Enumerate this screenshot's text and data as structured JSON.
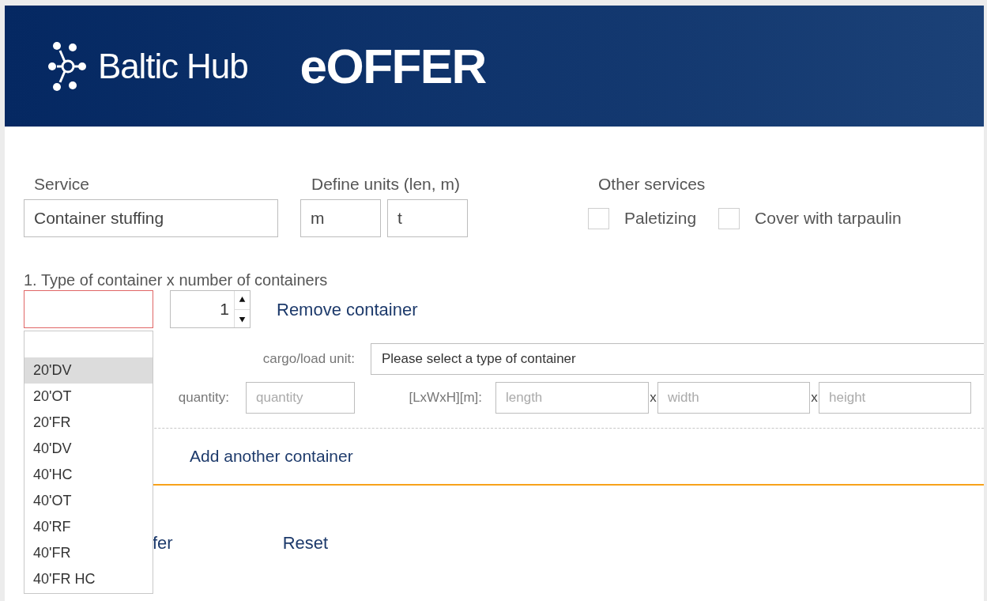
{
  "header": {
    "logo_text": "Baltic Hub",
    "app_title": "eOFFER"
  },
  "service": {
    "label": "Service",
    "value": "Container stuffing"
  },
  "units": {
    "label": "Define units (len, m)",
    "length": "m",
    "weight": "t"
  },
  "other_services": {
    "label": "Other services",
    "options": [
      {
        "label": "Paletizing",
        "checked": false
      },
      {
        "label": "Cover with tarpaulin",
        "checked": false
      }
    ]
  },
  "container_section": {
    "title": "1. Type of container x number of containers",
    "type_select": {
      "invalid": true,
      "open": true,
      "options": [
        {
          "label": "20'DV",
          "selected": true
        },
        {
          "label": "20'OT",
          "selected": false
        },
        {
          "label": "20'FR",
          "selected": false
        },
        {
          "label": "40'DV",
          "selected": false
        },
        {
          "label": "40'HC",
          "selected": false
        },
        {
          "label": "40'OT",
          "selected": false
        },
        {
          "label": "40'RF",
          "selected": false
        },
        {
          "label": "40'FR",
          "selected": false
        },
        {
          "label": "40'FR HC",
          "selected": false
        }
      ]
    },
    "count": "1",
    "remove_link": "Remove container",
    "cargo_label": "cargo/load unit:",
    "cargo_value": "Please select a type of container",
    "quantity_label": "quantity:",
    "quantity_placeholder": "quantity",
    "dims_label": "[LxWxH][m]:",
    "length_placeholder": "length",
    "width_placeholder": "width",
    "height_placeholder": "height",
    "separators": [
      "x",
      "x"
    ]
  },
  "add_link": "Add another container",
  "actions": [
    "fer",
    "Reset"
  ]
}
